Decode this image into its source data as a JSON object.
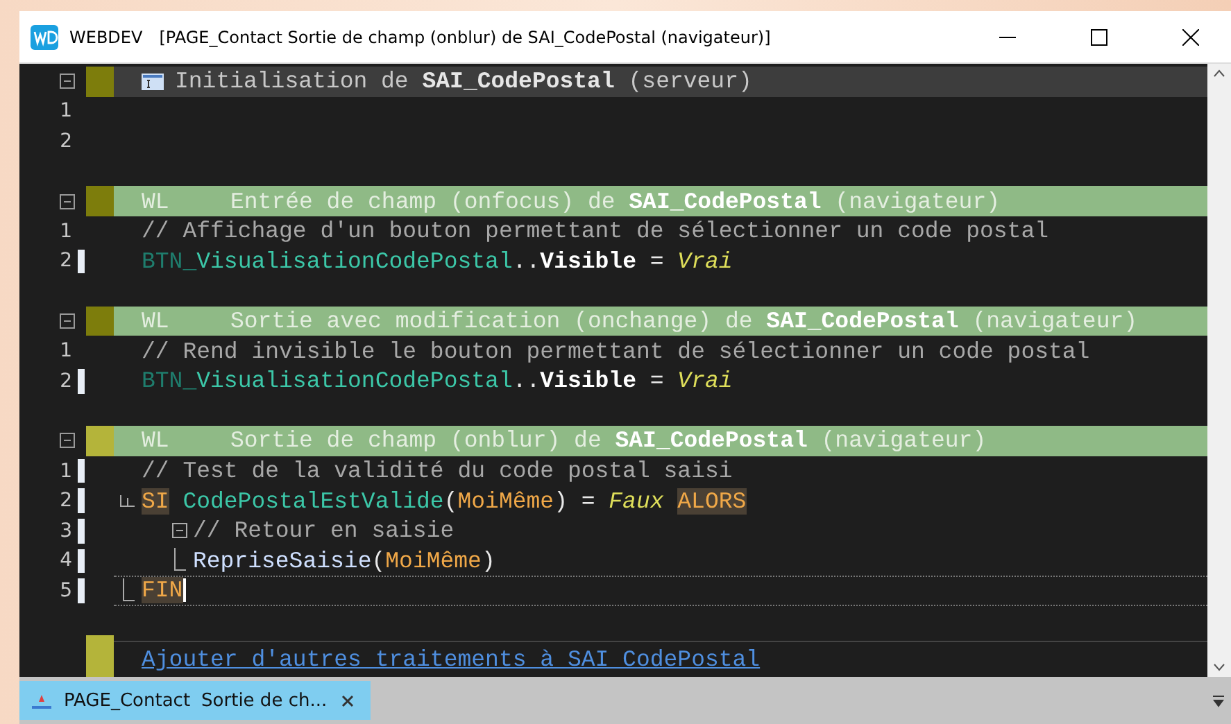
{
  "window": {
    "app": "WEBDEV",
    "title": "[PAGE_Contact   Sortie de champ (onblur) de SAI_CodePostal (navigateur)]"
  },
  "sections": [
    {
      "kind": "init",
      "active": false,
      "title": "Initialisation de **SAI_CodePostal** (serveur)",
      "lines": [
        {
          "number": "1",
          "kind": "plain",
          "marked": false,
          "current": false
        },
        {
          "number": "2",
          "kind": "plain",
          "marked": false,
          "current": false
        }
      ]
    },
    {
      "kind": "event",
      "active": false,
      "tag": "WL",
      "title": "Entrée de champ (onfocus) de **SAI_CodePostal** (navigateur)",
      "lines": [
        {
          "number": "1",
          "kind": "plain",
          "marked": false,
          "current": false,
          "tokens": [
            {
              "kind": "comment",
              "text": "// Affichage d'un bouton permettant de sélectionner un code postal"
            }
          ]
        },
        {
          "number": "2",
          "kind": "plain",
          "marked": true,
          "current": false,
          "tokens": [
            {
              "kind": "prefix",
              "text": "BTN_"
            },
            {
              "kind": "control",
              "text": "VisualisationCodePostal"
            },
            {
              "kind": "op",
              "text": ".."
            },
            {
              "kind": "member",
              "text": "Visible"
            },
            {
              "kind": "op",
              "text": "=",
              "spaced": true
            },
            {
              "kind": "value",
              "text": "Vrai",
              "spaced": true
            }
          ]
        }
      ]
    },
    {
      "kind": "event",
      "active": false,
      "tag": "WL",
      "title": "Sortie avec modification (onchange) de **SAI_CodePostal** (navigateur)",
      "lines": [
        {
          "number": "1",
          "kind": "plain",
          "marked": false,
          "current": false,
          "tokens": [
            {
              "kind": "comment",
              "text": "// Rend invisible le bouton permettant de sélectionner un code postal"
            }
          ]
        },
        {
          "number": "2",
          "kind": "plain",
          "marked": true,
          "current": false,
          "tokens": [
            {
              "kind": "prefix",
              "text": "BTN_"
            },
            {
              "kind": "control",
              "text": "VisualisationCodePostal"
            },
            {
              "kind": "op",
              "text": ".."
            },
            {
              "kind": "member",
              "text": "Visible"
            },
            {
              "kind": "op",
              "text": "=",
              "spaced": true
            },
            {
              "kind": "value",
              "text": "Vrai",
              "spaced": true
            }
          ]
        }
      ]
    },
    {
      "kind": "event",
      "active": true,
      "tag": "WL",
      "title": "Sortie de champ (onblur) de **SAI_CodePostal** (navigateur)",
      "lines": [
        {
          "number": "1",
          "kind": "plain",
          "marked": true,
          "current": false,
          "tokens": [
            {
              "kind": "comment",
              "text": "// Test de la validité du code postal saisi"
            }
          ]
        },
        {
          "number": "2",
          "kind": "block_open",
          "marked": true,
          "current": false,
          "tokens": [
            {
              "kind": "keyword",
              "text": "SI"
            },
            {
              "kind": "func",
              "text": "CodePostalEstValide",
              "spaced": true
            },
            {
              "kind": "op",
              "text": "("
            },
            {
              "kind": "param",
              "text": "MoiMême"
            },
            {
              "kind": "op",
              "text": ")"
            },
            {
              "kind": "op",
              "text": "=",
              "spaced": true
            },
            {
              "kind": "value",
              "text": "Faux",
              "spaced": true
            },
            {
              "kind": "keyword",
              "text": "ALORS",
              "spaced": true
            }
          ],
          "children": [
            {
              "number": "3",
              "kind": "block_toggle",
              "marked": true,
              "current": false,
              "tokens": [
                {
                  "kind": "comment",
                  "text": "// Retour en saisie"
                }
              ]
            },
            {
              "number": "4",
              "kind": "block_end",
              "marked": true,
              "current": false,
              "tokens": [
                {
                  "kind": "call",
                  "text": "RepriseSaisie"
                },
                {
                  "kind": "op",
                  "text": "("
                },
                {
                  "kind": "param",
                  "text": "MoiMême"
                },
                {
                  "kind": "op",
                  "text": ")"
                }
              ]
            }
          ]
        },
        {
          "number": "5",
          "kind": "block_end",
          "marked": true,
          "current": true,
          "tokens": [
            {
              "kind": "keyword",
              "text": "FIN"
            }
          ]
        }
      ]
    }
  ],
  "add_link": "Ajouter d'autres traitements à SAI_CodePostal",
  "tabs": [
    {
      "label": "PAGE_Contact",
      "detail": "Sortie de ch...",
      "selected": true
    }
  ]
}
